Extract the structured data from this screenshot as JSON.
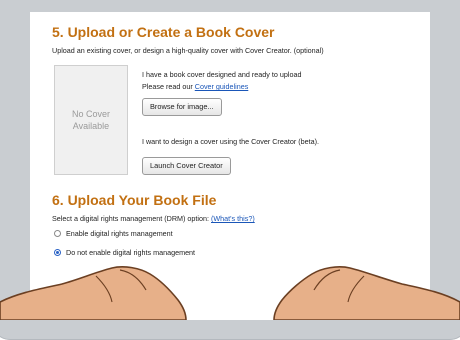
{
  "cover_section": {
    "title": "5. Upload or Create a Book Cover",
    "subtitle": "Upload an existing cover, or design a high-quality cover with Cover Creator. (optional)",
    "placeholder": "No Cover\nAvailable",
    "upload_text": "I have a book cover designed and ready to upload",
    "guidelines_prefix": "Please read our",
    "guidelines_link": "Cover guidelines",
    "browse_button": "Browse for image...",
    "creator_text": "I want to design a cover using the Cover Creator (beta).",
    "launch_button": "Launch Cover Creator"
  },
  "file_section": {
    "title": "6. Upload Your Book File",
    "drm_prompt": "Select a digital rights management (DRM) option:",
    "whats_this_link": "(What's this?)",
    "options": [
      {
        "label": "Enable digital rights management",
        "selected": false
      },
      {
        "label": "Do not enable digital rights management",
        "selected": true
      }
    ]
  },
  "colors": {
    "heading": "#c27012",
    "link": "#1a56b8",
    "bezel": "#c9cdd1"
  }
}
